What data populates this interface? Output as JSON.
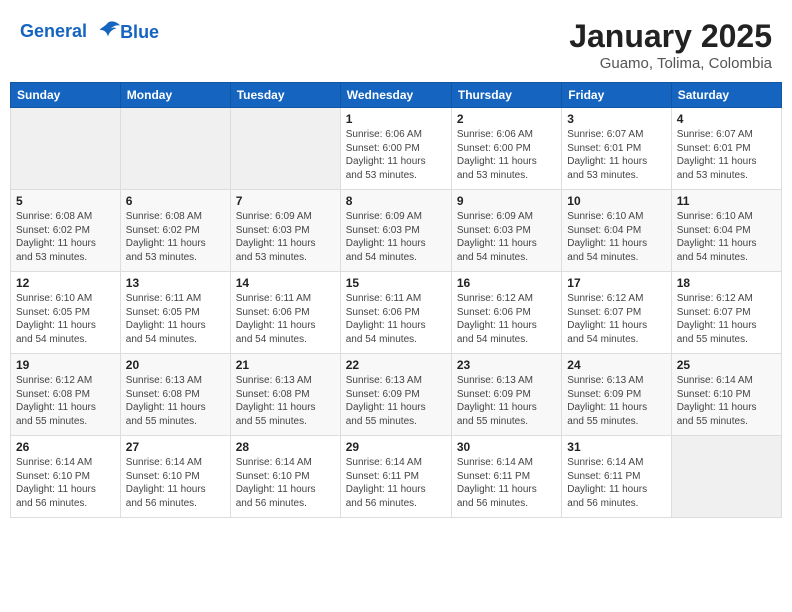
{
  "header": {
    "logo_line1": "General",
    "logo_line2": "Blue",
    "month": "January 2025",
    "location": "Guamo, Tolima, Colombia"
  },
  "weekdays": [
    "Sunday",
    "Monday",
    "Tuesday",
    "Wednesday",
    "Thursday",
    "Friday",
    "Saturday"
  ],
  "weeks": [
    [
      {
        "day": "",
        "info": ""
      },
      {
        "day": "",
        "info": ""
      },
      {
        "day": "",
        "info": ""
      },
      {
        "day": "1",
        "info": "Sunrise: 6:06 AM\nSunset: 6:00 PM\nDaylight: 11 hours\nand 53 minutes."
      },
      {
        "day": "2",
        "info": "Sunrise: 6:06 AM\nSunset: 6:00 PM\nDaylight: 11 hours\nand 53 minutes."
      },
      {
        "day": "3",
        "info": "Sunrise: 6:07 AM\nSunset: 6:01 PM\nDaylight: 11 hours\nand 53 minutes."
      },
      {
        "day": "4",
        "info": "Sunrise: 6:07 AM\nSunset: 6:01 PM\nDaylight: 11 hours\nand 53 minutes."
      }
    ],
    [
      {
        "day": "5",
        "info": "Sunrise: 6:08 AM\nSunset: 6:02 PM\nDaylight: 11 hours\nand 53 minutes."
      },
      {
        "day": "6",
        "info": "Sunrise: 6:08 AM\nSunset: 6:02 PM\nDaylight: 11 hours\nand 53 minutes."
      },
      {
        "day": "7",
        "info": "Sunrise: 6:09 AM\nSunset: 6:03 PM\nDaylight: 11 hours\nand 53 minutes."
      },
      {
        "day": "8",
        "info": "Sunrise: 6:09 AM\nSunset: 6:03 PM\nDaylight: 11 hours\nand 54 minutes."
      },
      {
        "day": "9",
        "info": "Sunrise: 6:09 AM\nSunset: 6:03 PM\nDaylight: 11 hours\nand 54 minutes."
      },
      {
        "day": "10",
        "info": "Sunrise: 6:10 AM\nSunset: 6:04 PM\nDaylight: 11 hours\nand 54 minutes."
      },
      {
        "day": "11",
        "info": "Sunrise: 6:10 AM\nSunset: 6:04 PM\nDaylight: 11 hours\nand 54 minutes."
      }
    ],
    [
      {
        "day": "12",
        "info": "Sunrise: 6:10 AM\nSunset: 6:05 PM\nDaylight: 11 hours\nand 54 minutes."
      },
      {
        "day": "13",
        "info": "Sunrise: 6:11 AM\nSunset: 6:05 PM\nDaylight: 11 hours\nand 54 minutes."
      },
      {
        "day": "14",
        "info": "Sunrise: 6:11 AM\nSunset: 6:06 PM\nDaylight: 11 hours\nand 54 minutes."
      },
      {
        "day": "15",
        "info": "Sunrise: 6:11 AM\nSunset: 6:06 PM\nDaylight: 11 hours\nand 54 minutes."
      },
      {
        "day": "16",
        "info": "Sunrise: 6:12 AM\nSunset: 6:06 PM\nDaylight: 11 hours\nand 54 minutes."
      },
      {
        "day": "17",
        "info": "Sunrise: 6:12 AM\nSunset: 6:07 PM\nDaylight: 11 hours\nand 54 minutes."
      },
      {
        "day": "18",
        "info": "Sunrise: 6:12 AM\nSunset: 6:07 PM\nDaylight: 11 hours\nand 55 minutes."
      }
    ],
    [
      {
        "day": "19",
        "info": "Sunrise: 6:12 AM\nSunset: 6:08 PM\nDaylight: 11 hours\nand 55 minutes."
      },
      {
        "day": "20",
        "info": "Sunrise: 6:13 AM\nSunset: 6:08 PM\nDaylight: 11 hours\nand 55 minutes."
      },
      {
        "day": "21",
        "info": "Sunrise: 6:13 AM\nSunset: 6:08 PM\nDaylight: 11 hours\nand 55 minutes."
      },
      {
        "day": "22",
        "info": "Sunrise: 6:13 AM\nSunset: 6:09 PM\nDaylight: 11 hours\nand 55 minutes."
      },
      {
        "day": "23",
        "info": "Sunrise: 6:13 AM\nSunset: 6:09 PM\nDaylight: 11 hours\nand 55 minutes."
      },
      {
        "day": "24",
        "info": "Sunrise: 6:13 AM\nSunset: 6:09 PM\nDaylight: 11 hours\nand 55 minutes."
      },
      {
        "day": "25",
        "info": "Sunrise: 6:14 AM\nSunset: 6:10 PM\nDaylight: 11 hours\nand 55 minutes."
      }
    ],
    [
      {
        "day": "26",
        "info": "Sunrise: 6:14 AM\nSunset: 6:10 PM\nDaylight: 11 hours\nand 56 minutes."
      },
      {
        "day": "27",
        "info": "Sunrise: 6:14 AM\nSunset: 6:10 PM\nDaylight: 11 hours\nand 56 minutes."
      },
      {
        "day": "28",
        "info": "Sunrise: 6:14 AM\nSunset: 6:10 PM\nDaylight: 11 hours\nand 56 minutes."
      },
      {
        "day": "29",
        "info": "Sunrise: 6:14 AM\nSunset: 6:11 PM\nDaylight: 11 hours\nand 56 minutes."
      },
      {
        "day": "30",
        "info": "Sunrise: 6:14 AM\nSunset: 6:11 PM\nDaylight: 11 hours\nand 56 minutes."
      },
      {
        "day": "31",
        "info": "Sunrise: 6:14 AM\nSunset: 6:11 PM\nDaylight: 11 hours\nand 56 minutes."
      },
      {
        "day": "",
        "info": ""
      }
    ]
  ]
}
